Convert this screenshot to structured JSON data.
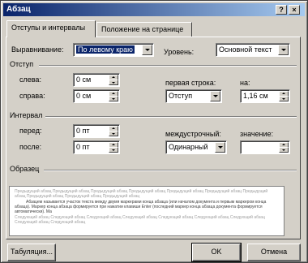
{
  "window": {
    "title": "Абзац",
    "help_glyph": "?",
    "close_glyph": "×"
  },
  "tabs": [
    {
      "label": "Отступы и интервалы",
      "active": true
    },
    {
      "label": "Положение на странице",
      "active": false
    }
  ],
  "general": {
    "alignment_label": "Выравнивание:",
    "alignment_value": "По левому краю",
    "level_label": "Уровень:",
    "level_value": "Основной текст"
  },
  "indent": {
    "group_label": "Отступ",
    "left_label": "слева:",
    "left_value": "0 см",
    "right_label": "справа:",
    "right_value": "0 см",
    "first_line_label": "первая строка:",
    "first_line_value": "Отступ",
    "by_label": "на:",
    "by_value": "1,16 см"
  },
  "spacing": {
    "group_label": "Интервал",
    "before_label": "перед:",
    "before_value": "0 пт",
    "after_label": "после:",
    "after_value": "0 пт",
    "line_spacing_label": "междустрочный:",
    "line_spacing_value": "Одинарный",
    "at_label": "значение:",
    "at_value": ""
  },
  "preview": {
    "group_label": "Образец",
    "prev_text": "Предыдущий абзац Предыдущий абзац Предыдущий абзац Предыдущий абзац Предыдущий абзац Предыдущий абзац Предыдущий абзац Предыдущий абзац Предыдущий абзац Предыдущий абзац",
    "current_text": "Абзацем называется участок текста между двумя маркерами конца абзаца (или началом документа и первым маркером конца абзаца). Маркер конца абзаца формируется при нажатии клавиши Enter (последний маркер конца абзаца документа формируется автоматически). Ма",
    "next_text": "Следующий абзац Следующий абзац Следующий абзац Следующий абзац Следующий абзац Следующий абзац Следующий абзац Следующий абзац Следующий абзац"
  },
  "buttons": {
    "tabs": "Табуляция...",
    "ok": "OK",
    "cancel": "Отмена"
  }
}
